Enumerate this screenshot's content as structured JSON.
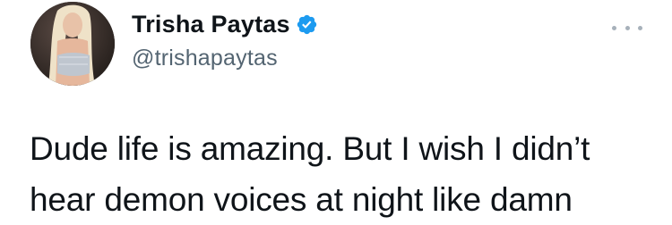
{
  "author": {
    "display_name": "Trisha Paytas",
    "handle": "@trishapaytas",
    "verified": true
  },
  "tweet": {
    "text_lines": [
      "Dude life is amazing. But I wish I didn’t",
      "hear demon voices at night like damn"
    ]
  },
  "colors": {
    "text": "#0f1419",
    "secondary": "#536471",
    "verified_badge": "#1d9bf0",
    "more_dots": "#a7b1ba"
  },
  "icons": {
    "verified": "verified-badge-icon",
    "more": "more-options-icon"
  }
}
